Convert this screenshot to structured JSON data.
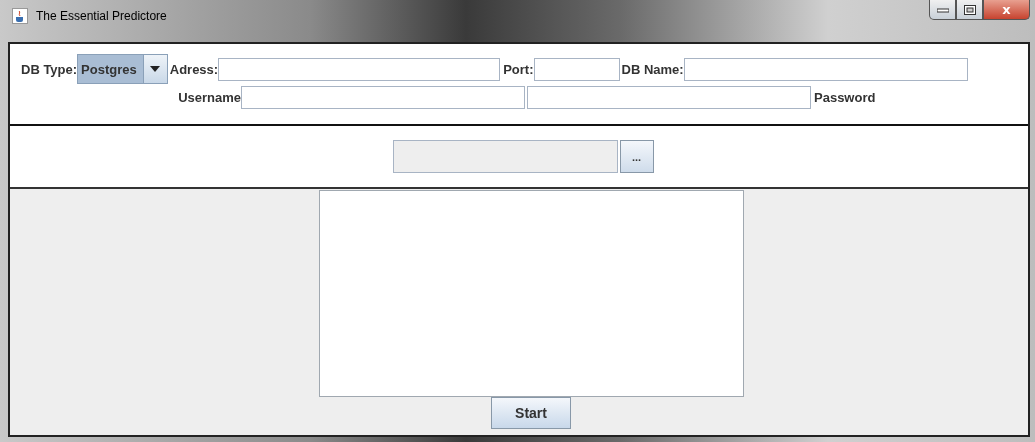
{
  "window": {
    "title": "The Essential Predictore",
    "controls": [
      {
        "kind": "minimize"
      },
      {
        "kind": "maximize"
      },
      {
        "kind": "close",
        "label": "x"
      }
    ]
  },
  "connection": {
    "db_type": {
      "label": "DB Type:",
      "value": "Postgres"
    },
    "address": {
      "label": "Adress:"
    },
    "port": {
      "label": "Port:"
    },
    "db_name": {
      "label": "DB Name:"
    },
    "username": {
      "label": "Username"
    },
    "password": {
      "label": "Password"
    }
  },
  "file_chooser": {
    "browse_button": "...",
    "disabled": true
  },
  "output": {
    "start_button": "Start"
  }
}
